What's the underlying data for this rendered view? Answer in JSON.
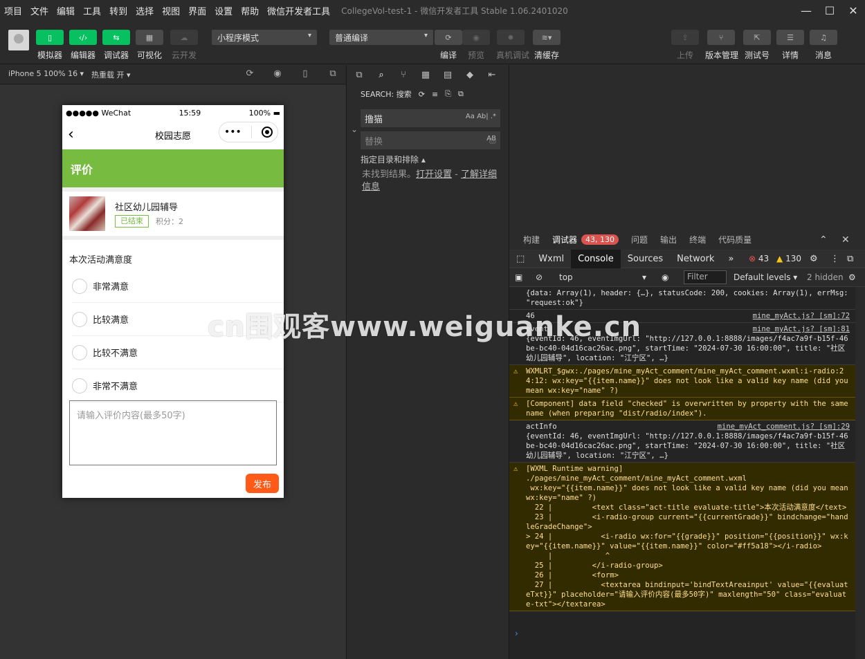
{
  "menu": [
    "项目",
    "文件",
    "编辑",
    "工具",
    "转到",
    "选择",
    "视图",
    "界面",
    "设置",
    "帮助",
    "微信开发者工具"
  ],
  "window_title": "CollegeVol-test-1 - 微信开发者工具 Stable 1.06.2401020",
  "toolbar": {
    "simulator": "模拟器",
    "editor": "编辑器",
    "debugger": "调试器",
    "visual": "可视化",
    "cloud": "云开发",
    "mode_select": "小程序模式",
    "compile_select": "普通编译",
    "compile": "编译",
    "preview": "预览",
    "real_debug": "真机调试",
    "clear_cache": "清缓存",
    "upload": "上传",
    "version": "版本管理",
    "test_id": "测试号",
    "details": "详情",
    "messages": "消息"
  },
  "simbar": {
    "device": "iPhone 5 100% 16 ▾",
    "hot_reload": "热重载 开 ▾"
  },
  "phone": {
    "carrier": "●●●●● WeChat",
    "time": "15:59",
    "battery": "100%",
    "nav_title": "校园志愿",
    "header": "评价",
    "activity_title": "社区幼儿园辅导",
    "status_badge": "已结束",
    "points": "积分：2",
    "section_title": "本次活动满意度",
    "options": [
      "非常满意",
      "比较满意",
      "比较不满意",
      "非常不满意"
    ],
    "textarea_placeholder": "请输入评价内容(最多50字)",
    "submit": "发布"
  },
  "search": {
    "header": "SEARCH: 搜索",
    "query": "撸猫",
    "replace_placeholder": "替换",
    "include_exclude": "指定目录和排除 ▴",
    "no_results": "未找到结果。",
    "open_settings": "打开设置",
    "sep": " - ",
    "learn_more": "了解详细信息",
    "opt_case": "Aa",
    "opt_word": "Ab|",
    "opt_regex": ".*",
    "opt_replace": "AB"
  },
  "devtools": {
    "tabs": [
      "构建",
      "调试器",
      "问题",
      "输出",
      "终端",
      "代码质量"
    ],
    "debugger_badge": "43, 130",
    "subtabs": [
      "Wxml",
      "Console",
      "Sources",
      "Network"
    ],
    "errors": "43",
    "warnings": "130",
    "context": "top",
    "filter_placeholder": "Filter",
    "levels": "Default levels ▾",
    "hidden": "2 hidden",
    "console": [
      {
        "type": "log",
        "text": "{data: Array(1), header: {…}, statusCode: 200, cookies: Array(1), errMsg: \"request:ok\"}",
        "src": ""
      },
      {
        "type": "log",
        "text": "46",
        "src": "mine_myAct.js? [sm]:72"
      },
      {
        "type": "log",
        "text": "event\n{eventId: 46, eventImgUrl: \"http://127.0.0.1:8888/images/f4ac7a9f-b15f-46be-bc40-04d16cac26ac.png\", startTime: \"2024-07-30 16:00:00\", title: \"社区幼儿园辅导\", location: \"江宁区\", …}",
        "src": "mine_myAct.js? [sm]:81"
      },
      {
        "type": "warn",
        "text": "WXMLRT_$gwx:./pages/mine_myAct_comment/mine_myAct_comment.wxml:i-radio:24:12: wx:key=\"{{item.name}}\" does not look like a valid key name (did you mean wx:key=\"name\" ?)",
        "src": ""
      },
      {
        "type": "warn",
        "text": "[Component] data field \"checked\" is overwritten by property with the same name (when preparing \"dist/radio/index\").",
        "src": ""
      },
      {
        "type": "log",
        "text": "actInfo\n{eventId: 46, eventImgUrl: \"http://127.0.0.1:8888/images/f4ac7a9f-b15f-46be-bc40-04d16cac26ac.png\", startTime: \"2024-07-30 16:00:00\", title: \"社区幼儿园辅导\", location: \"江宁区\", …}",
        "src": "mine_myAct_comment.js? [sm]:29"
      },
      {
        "type": "warn",
        "text": "[WXML Runtime warning]\n./pages/mine_myAct_comment/mine_myAct_comment.wxml\n wx:key=\"{{item.name}}\" does not look like a valid key name (did you mean wx:key=\"name\" ?)\n  22 |         <text class=\"act-title evaluate-title\">本次活动满意度</text>\n  23 |         <i-radio-group current=\"{{currentGrade}}\" bindchange=\"handleGradeChange\">\n> 24 |           <i-radio wx:for=\"{{grade}}\" position=\"{{position}}\" wx:key=\"{{item.name}}\" value=\"{{item.name}}\" color=\"#ff5a18\"></i-radio>\n     |            ^\n  25 |         </i-radio-group>\n  26 |         <form>\n  27 |           <textarea bindinput='bindTextAreainput' value=\"{{evaluateTxt}}\" placeholder=\"请输入评价内容(最多50字)\" maxlength=\"50\" class=\"evaluate-txt\"></textarea>",
        "src": ""
      }
    ]
  },
  "watermark": "cn围观客www.weiguanke.cn",
  "colors": {
    "green": "#07c160",
    "header_green": "#77bb41",
    "submit_orange": "#ff5a18"
  }
}
